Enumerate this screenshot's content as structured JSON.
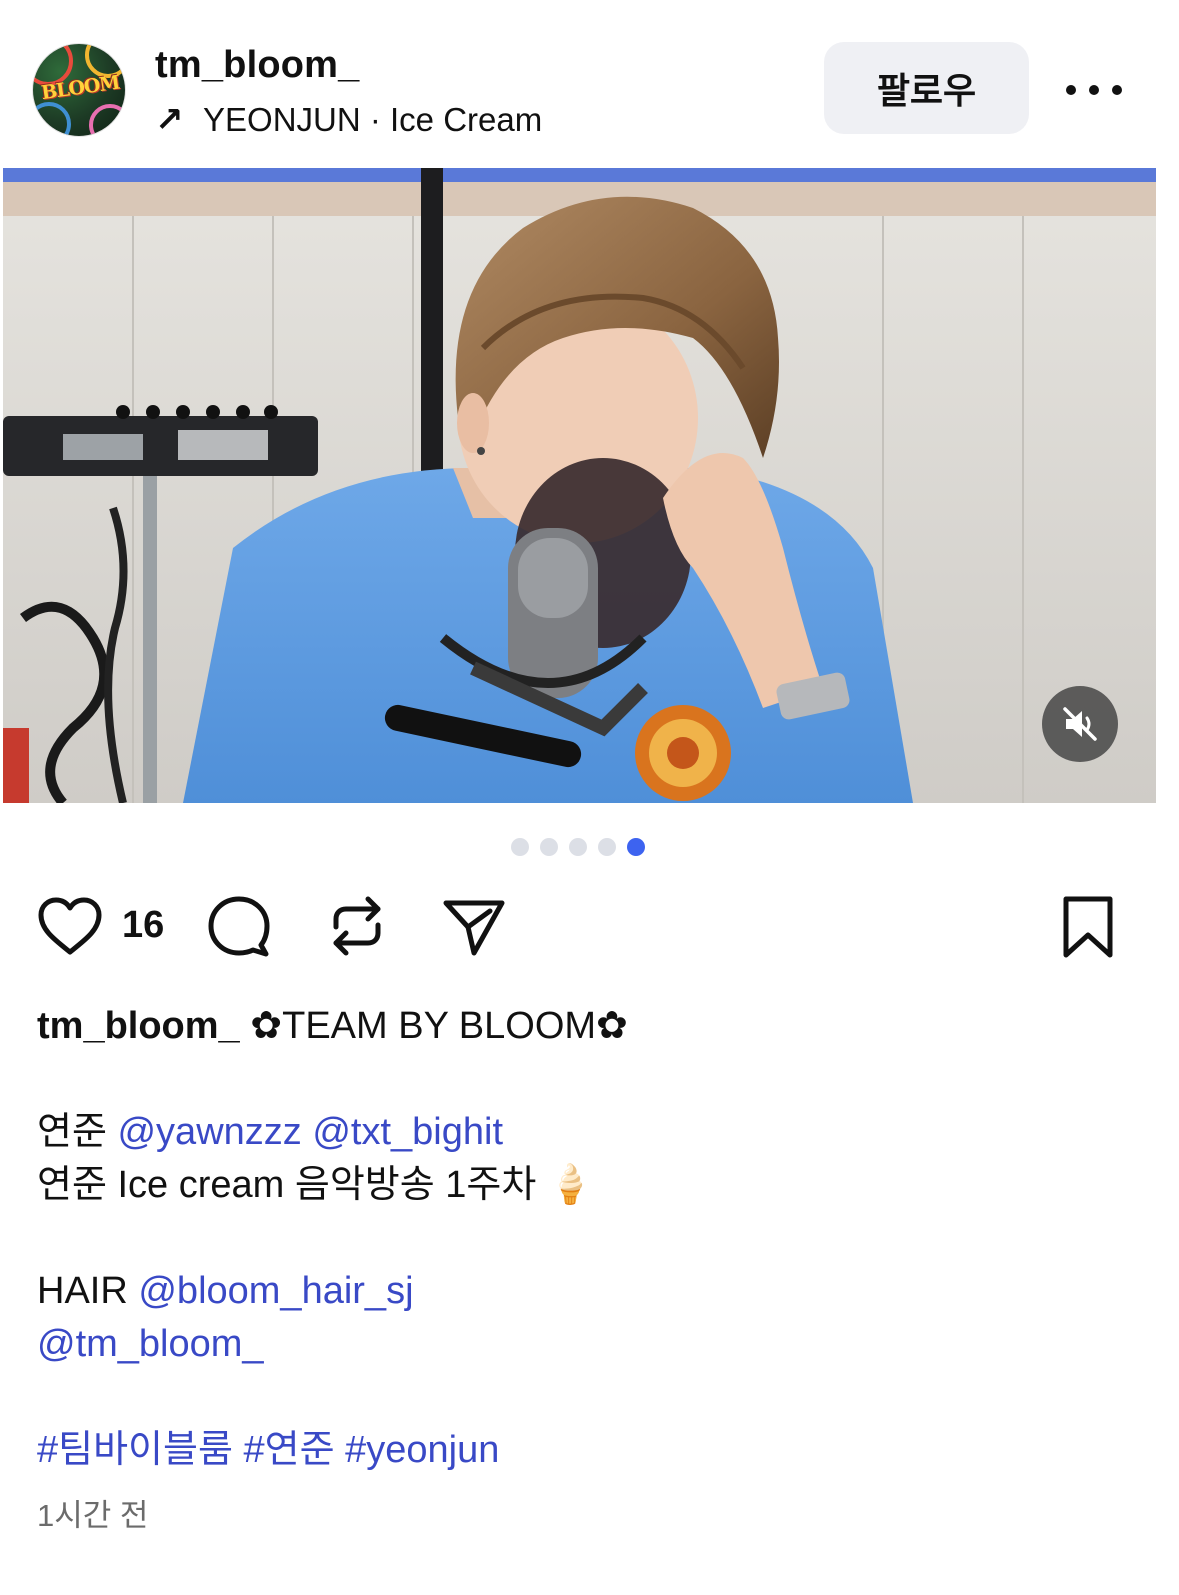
{
  "header": {
    "username": "tm_bloom_",
    "avatar_text": "BLOOM",
    "music_arrow": "↗",
    "music": "YEONJUN · Ice Cream",
    "follow_label": "팔로우"
  },
  "media": {
    "mute_icon": "speaker-muted-icon",
    "carousel_total": 5,
    "carousel_active": 5
  },
  "actions": {
    "like_count": "16"
  },
  "caption": {
    "username": "tm_bloom_",
    "title": "✿TEAM BY BLOOM✿",
    "line1_text": "연준 ",
    "line1_mention1": "@yawnzzz",
    "line1_mention2": "@txt_bighit",
    "line2_text": "연준 Ice cream 음악방송 1주차 🍦",
    "line3_text": "HAIR ",
    "line3_mention": "@bloom_hair_sj",
    "line4_mention": "@tm_bloom_",
    "hashtag1": "#팀바이블룸",
    "hashtag2": "#연준",
    "hashtag3": "#yeonjun"
  },
  "timestamp": "1시간 전",
  "colors": {
    "link": "#3949c6",
    "active_dot": "#3d63f0",
    "follow_bg": "#eff0f4"
  }
}
